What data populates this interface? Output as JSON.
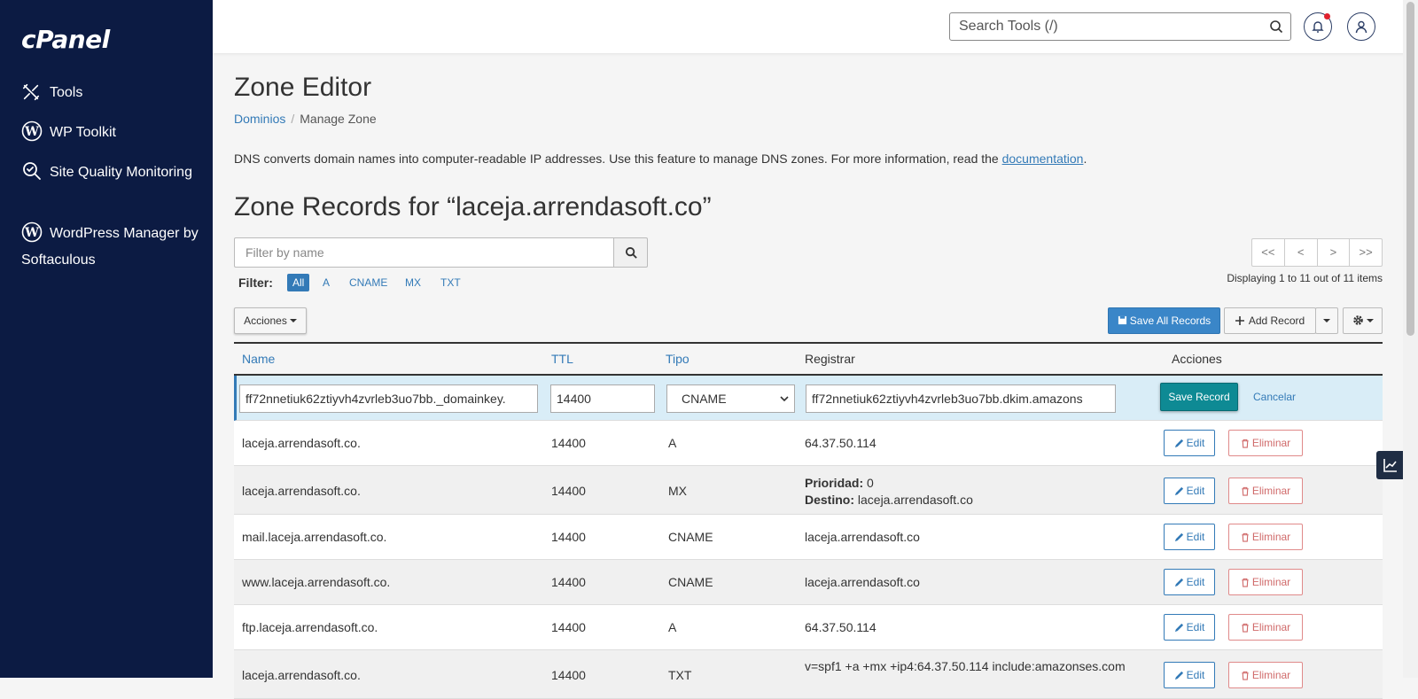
{
  "sidebar": {
    "logo": "cPanel",
    "items": [
      {
        "label": "Tools",
        "icon": "tools-icon"
      },
      {
        "label": "WP Toolkit",
        "icon": "wordpress-icon"
      },
      {
        "label": "Site Quality Monitoring",
        "icon": "site-quality-icon"
      },
      {
        "label": "WordPress Manager by Softaculous",
        "icon": "wordpress-icon"
      }
    ]
  },
  "header": {
    "search_placeholder": "Search Tools (/)"
  },
  "page": {
    "title": "Zone Editor",
    "breadcrumb": [
      "Dominios",
      "Manage Zone"
    ],
    "intro_text": "DNS converts domain names into computer-readable IP addresses. Use this feature to manage DNS zones. For more information, read the ",
    "intro_link": "documentation",
    "intro_end": "."
  },
  "zone": {
    "title": "Zone Records for “laceja.arrendasoft.co”",
    "filter_placeholder": "Filter by name",
    "filter_label": "Filter:",
    "filter_chips": [
      "All",
      "A",
      "CNAME",
      "MX",
      "TXT"
    ],
    "pager": [
      "<<",
      "<",
      ">",
      ">>"
    ],
    "displaying": "Displaying 1 to 11 out of 11 items",
    "acciones_label": "Acciones",
    "save_all_label": "Save All Records",
    "add_record_label": "Add Record"
  },
  "table": {
    "headers": {
      "name": "Name",
      "ttl": "TTL",
      "tipo": "Tipo",
      "registrar": "Registrar",
      "acciones": "Acciones"
    },
    "edit_row": {
      "name": "ff72nnetiuk62ztiyvh4zvrleb3uo7bb._domainkey.",
      "ttl": "14400",
      "type": "CNAME",
      "record": "ff72nnetiuk62ztiyvh4zvrleb3uo7bb.dkim.amazons",
      "save_label": "Save Record",
      "cancel_label": "Cancelar"
    },
    "rows": [
      {
        "name": "laceja.arrendasoft.co.",
        "ttl": "14400",
        "type": "A",
        "record": "64.37.50.114"
      },
      {
        "name": "laceja.arrendasoft.co.",
        "ttl": "14400",
        "type": "MX",
        "prio_label": "Prioridad:",
        "prio": " 0",
        "dest_label": "Destino:",
        "dest": " laceja.arrendasoft.co"
      },
      {
        "name": "mail.laceja.arrendasoft.co.",
        "ttl": "14400",
        "type": "CNAME",
        "record": "laceja.arrendasoft.co"
      },
      {
        "name": "www.laceja.arrendasoft.co.",
        "ttl": "14400",
        "type": "CNAME",
        "record": "laceja.arrendasoft.co"
      },
      {
        "name": "ftp.laceja.arrendasoft.co.",
        "ttl": "14400",
        "type": "A",
        "record": "64.37.50.114"
      },
      {
        "name": "laceja.arrendasoft.co.",
        "ttl": "14400",
        "type": "TXT",
        "record": "v=spf1 +a +mx +ip4:64.37.50.114 include:amazonses.com"
      }
    ],
    "edit_label": "Edit",
    "delete_label": "Eliminar"
  }
}
